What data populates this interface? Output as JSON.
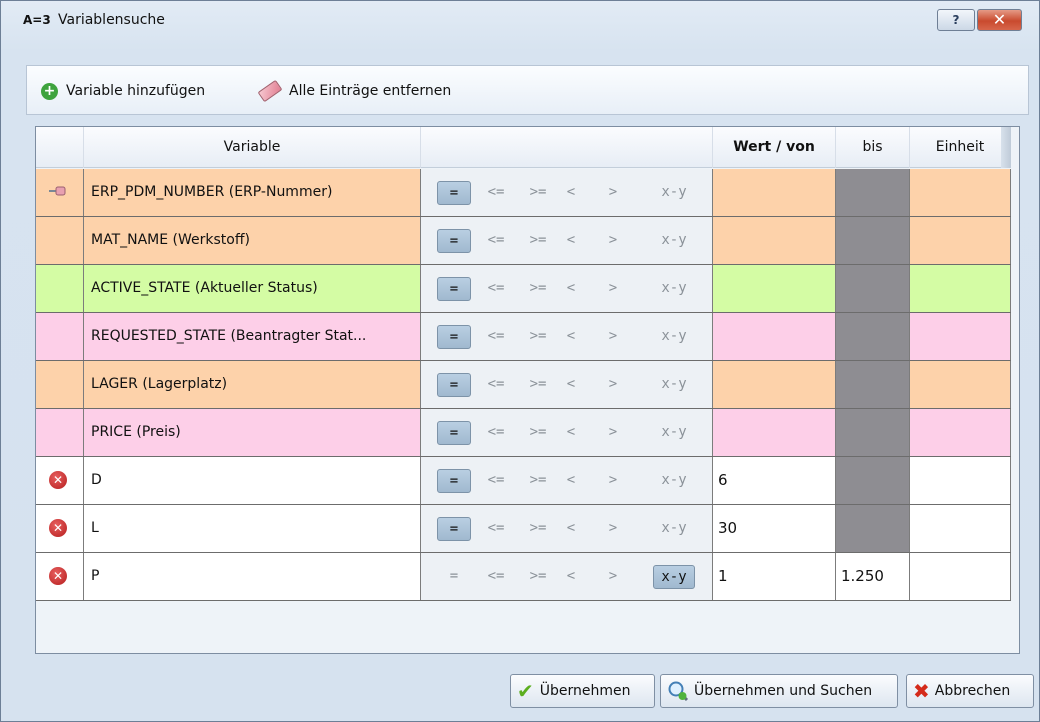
{
  "window": {
    "app_badge": "A=3",
    "title": "Variablensuche",
    "help_label": "?",
    "close_label": "✕"
  },
  "toolbar": {
    "add_label": "Variable hinzufügen",
    "clear_label": "Alle Einträge entfernen"
  },
  "table": {
    "headers": {
      "variable": "Variable",
      "wert": "Wert / von",
      "bis": "bis",
      "einheit": "Einheit"
    },
    "operators": [
      "=",
      "<=",
      ">=",
      "<",
      ">",
      "x-y"
    ],
    "rows": [
      {
        "variable": "ERP_PDM_NUMBER (ERP-Nummer)",
        "color": "#fdd2aa",
        "icon": "pin-icon",
        "selected_op": "=",
        "wert": "",
        "bis": ""
      },
      {
        "variable": "MAT_NAME (Werkstoff)",
        "color": "#fdd2aa",
        "icon": "",
        "selected_op": "=",
        "wert": "",
        "bis": ""
      },
      {
        "variable": "ACTIVE_STATE (Aktueller Status)",
        "color": "#d4fca4",
        "icon": "",
        "selected_op": "=",
        "wert": "",
        "bis": ""
      },
      {
        "variable": "REQUESTED_STATE (Beantragter Stat...",
        "color": "#fdcfe8",
        "icon": "",
        "selected_op": "=",
        "wert": "",
        "bis": ""
      },
      {
        "variable": "LAGER (Lagerplatz)",
        "color": "#fdd2aa",
        "icon": "",
        "selected_op": "=",
        "wert": "",
        "bis": ""
      },
      {
        "variable": "PRICE (Preis)",
        "color": "#fdcfe8",
        "icon": "",
        "selected_op": "=",
        "wert": "",
        "bis": ""
      },
      {
        "variable": "D",
        "color": "#ffffff",
        "icon": "delete-icon",
        "selected_op": "=",
        "wert": "6",
        "bis": ""
      },
      {
        "variable": "L",
        "color": "#ffffff",
        "icon": "delete-icon",
        "selected_op": "=",
        "wert": "30",
        "bis": ""
      },
      {
        "variable": "P",
        "color": "#ffffff",
        "icon": "delete-icon",
        "selected_op": "x-y",
        "wert": "1",
        "bis": "1.250"
      }
    ]
  },
  "buttons": {
    "apply": "Übernehmen",
    "apply_search": "Übernehmen und Suchen",
    "cancel": "Abbrechen"
  }
}
